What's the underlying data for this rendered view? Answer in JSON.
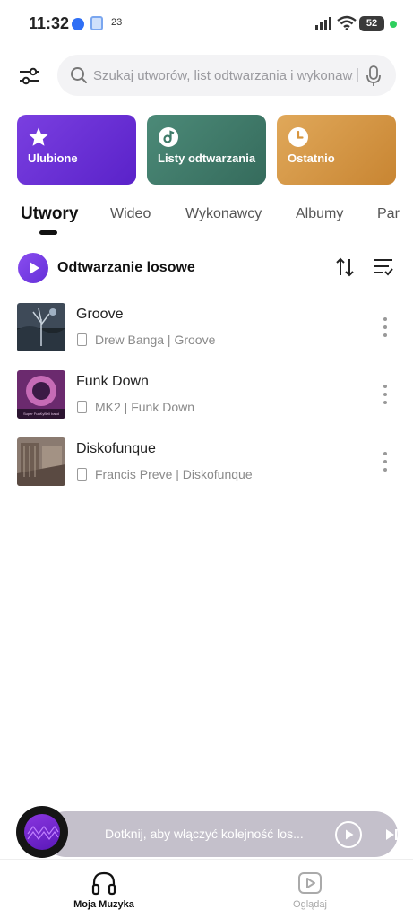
{
  "status_bar": {
    "time": "11:32",
    "notification_count": "23",
    "battery": "52"
  },
  "search": {
    "placeholder": "Szukaj utworów, list odtwarzania i wykonaw..."
  },
  "cards": [
    {
      "label": "Ulubione",
      "icon": "star-icon",
      "color": "#6a2fd6"
    },
    {
      "label": "Listy odtwarzania",
      "icon": "playlist-disc-icon",
      "color": "#3f7b69"
    },
    {
      "label": "Ostatnio",
      "icon": "clock-icon",
      "color": "#d8963f"
    }
  ],
  "tabs": [
    "Utwory",
    "Wideo",
    "Wykonawcy",
    "Albumy",
    "Par"
  ],
  "active_tab": "Utwory",
  "shuffle": {
    "label": "Odtwarzanie losowe"
  },
  "songs": [
    {
      "title": "Groove",
      "subtitle": "Drew Banga | Groove"
    },
    {
      "title": "Funk Down",
      "subtitle": "MK2 | Funk Down",
      "art_caption": "Super FunKyBell band"
    },
    {
      "title": "Diskofunque",
      "subtitle": "Francis Preve | Diskofunque"
    }
  ],
  "mini_player": {
    "text": "Dotknij, aby włączyć kolejność los..."
  },
  "nav": {
    "music": "Moja Muzyka",
    "watch": "Oglądaj"
  },
  "colors": {
    "accent": "#6a2fd6",
    "player_bar": "#c4c0cb"
  }
}
